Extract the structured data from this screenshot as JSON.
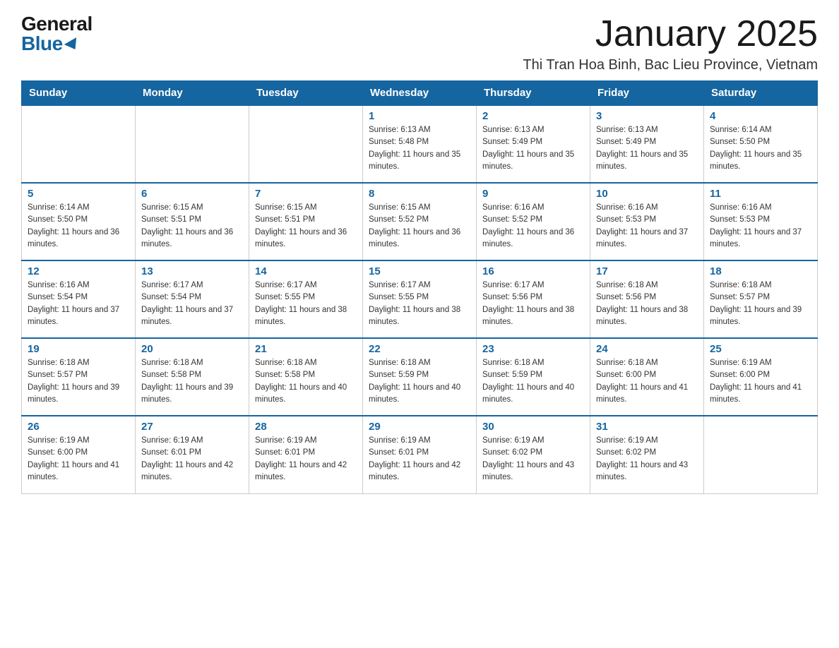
{
  "logo": {
    "general": "General",
    "blue": "Blue"
  },
  "header": {
    "month_title": "January 2025",
    "location": "Thi Tran Hoa Binh, Bac Lieu Province, Vietnam"
  },
  "days_of_week": [
    "Sunday",
    "Monday",
    "Tuesday",
    "Wednesday",
    "Thursday",
    "Friday",
    "Saturday"
  ],
  "weeks": [
    [
      {
        "day": null
      },
      {
        "day": null
      },
      {
        "day": null
      },
      {
        "day": 1,
        "sunrise": "6:13 AM",
        "sunset": "5:48 PM",
        "daylight": "11 hours and 35 minutes."
      },
      {
        "day": 2,
        "sunrise": "6:13 AM",
        "sunset": "5:49 PM",
        "daylight": "11 hours and 35 minutes."
      },
      {
        "day": 3,
        "sunrise": "6:13 AM",
        "sunset": "5:49 PM",
        "daylight": "11 hours and 35 minutes."
      },
      {
        "day": 4,
        "sunrise": "6:14 AM",
        "sunset": "5:50 PM",
        "daylight": "11 hours and 35 minutes."
      }
    ],
    [
      {
        "day": 5,
        "sunrise": "6:14 AM",
        "sunset": "5:50 PM",
        "daylight": "11 hours and 36 minutes."
      },
      {
        "day": 6,
        "sunrise": "6:15 AM",
        "sunset": "5:51 PM",
        "daylight": "11 hours and 36 minutes."
      },
      {
        "day": 7,
        "sunrise": "6:15 AM",
        "sunset": "5:51 PM",
        "daylight": "11 hours and 36 minutes."
      },
      {
        "day": 8,
        "sunrise": "6:15 AM",
        "sunset": "5:52 PM",
        "daylight": "11 hours and 36 minutes."
      },
      {
        "day": 9,
        "sunrise": "6:16 AM",
        "sunset": "5:52 PM",
        "daylight": "11 hours and 36 minutes."
      },
      {
        "day": 10,
        "sunrise": "6:16 AM",
        "sunset": "5:53 PM",
        "daylight": "11 hours and 37 minutes."
      },
      {
        "day": 11,
        "sunrise": "6:16 AM",
        "sunset": "5:53 PM",
        "daylight": "11 hours and 37 minutes."
      }
    ],
    [
      {
        "day": 12,
        "sunrise": "6:16 AM",
        "sunset": "5:54 PM",
        "daylight": "11 hours and 37 minutes."
      },
      {
        "day": 13,
        "sunrise": "6:17 AM",
        "sunset": "5:54 PM",
        "daylight": "11 hours and 37 minutes."
      },
      {
        "day": 14,
        "sunrise": "6:17 AM",
        "sunset": "5:55 PM",
        "daylight": "11 hours and 38 minutes."
      },
      {
        "day": 15,
        "sunrise": "6:17 AM",
        "sunset": "5:55 PM",
        "daylight": "11 hours and 38 minutes."
      },
      {
        "day": 16,
        "sunrise": "6:17 AM",
        "sunset": "5:56 PM",
        "daylight": "11 hours and 38 minutes."
      },
      {
        "day": 17,
        "sunrise": "6:18 AM",
        "sunset": "5:56 PM",
        "daylight": "11 hours and 38 minutes."
      },
      {
        "day": 18,
        "sunrise": "6:18 AM",
        "sunset": "5:57 PM",
        "daylight": "11 hours and 39 minutes."
      }
    ],
    [
      {
        "day": 19,
        "sunrise": "6:18 AM",
        "sunset": "5:57 PM",
        "daylight": "11 hours and 39 minutes."
      },
      {
        "day": 20,
        "sunrise": "6:18 AM",
        "sunset": "5:58 PM",
        "daylight": "11 hours and 39 minutes."
      },
      {
        "day": 21,
        "sunrise": "6:18 AM",
        "sunset": "5:58 PM",
        "daylight": "11 hours and 40 minutes."
      },
      {
        "day": 22,
        "sunrise": "6:18 AM",
        "sunset": "5:59 PM",
        "daylight": "11 hours and 40 minutes."
      },
      {
        "day": 23,
        "sunrise": "6:18 AM",
        "sunset": "5:59 PM",
        "daylight": "11 hours and 40 minutes."
      },
      {
        "day": 24,
        "sunrise": "6:18 AM",
        "sunset": "6:00 PM",
        "daylight": "11 hours and 41 minutes."
      },
      {
        "day": 25,
        "sunrise": "6:19 AM",
        "sunset": "6:00 PM",
        "daylight": "11 hours and 41 minutes."
      }
    ],
    [
      {
        "day": 26,
        "sunrise": "6:19 AM",
        "sunset": "6:00 PM",
        "daylight": "11 hours and 41 minutes."
      },
      {
        "day": 27,
        "sunrise": "6:19 AM",
        "sunset": "6:01 PM",
        "daylight": "11 hours and 42 minutes."
      },
      {
        "day": 28,
        "sunrise": "6:19 AM",
        "sunset": "6:01 PM",
        "daylight": "11 hours and 42 minutes."
      },
      {
        "day": 29,
        "sunrise": "6:19 AM",
        "sunset": "6:01 PM",
        "daylight": "11 hours and 42 minutes."
      },
      {
        "day": 30,
        "sunrise": "6:19 AM",
        "sunset": "6:02 PM",
        "daylight": "11 hours and 43 minutes."
      },
      {
        "day": 31,
        "sunrise": "6:19 AM",
        "sunset": "6:02 PM",
        "daylight": "11 hours and 43 minutes."
      },
      {
        "day": null
      }
    ]
  ],
  "labels": {
    "sunrise_prefix": "Sunrise: ",
    "sunset_prefix": "Sunset: ",
    "daylight_prefix": "Daylight: "
  }
}
